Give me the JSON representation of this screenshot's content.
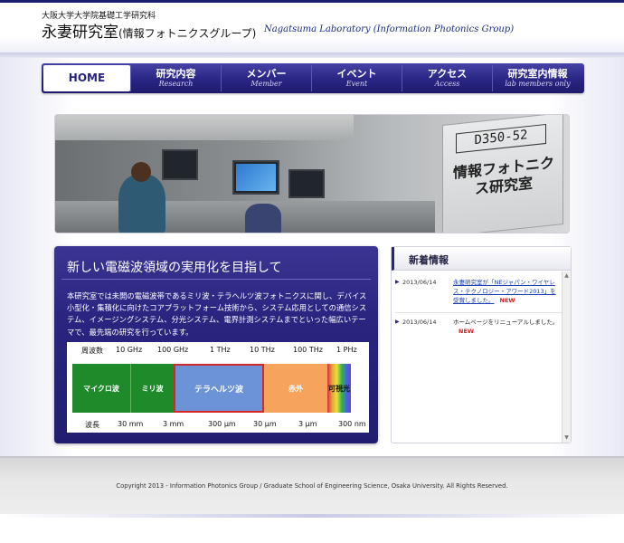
{
  "header": {
    "subtitle": "大阪大学大学院基礎工学研究科",
    "title": "永妻研究室",
    "title_paren": "(情報フォトニクスグループ)",
    "english": "Nagatsuma Laboratory (Information Photonics Group)"
  },
  "nav": {
    "items": [
      {
        "jp": "HOME",
        "en": ""
      },
      {
        "jp": "研究内容",
        "en": "Research"
      },
      {
        "jp": "メンバー",
        "en": "Member"
      },
      {
        "jp": "イベント",
        "en": "Event"
      },
      {
        "jp": "アクセス",
        "en": "Access"
      },
      {
        "jp": "研究室内情報",
        "en": "lab members only"
      }
    ],
    "active_index": 0
  },
  "hero": {
    "sign_number": "D350-52",
    "sign_text": "情報フォトニクス研究室"
  },
  "main": {
    "title": "新しい電磁波領域の実用化を目指して",
    "text": "本研究室では未開の電磁波帯であるミリ波・テラヘルツ波フォトニクスに関し、デバイス小型化・集積化に向けたコアプラットフォーム技術から、システム応用としての通信システム、イメージングシステム、分光システム、電界計測システムまでといった幅広いテーマで、最先端の研究を行っています。",
    "chart": {
      "freq_label": "周波数",
      "freq_ticks": [
        "10 GHz",
        "100 GHz",
        "1 THz",
        "10 THz",
        "100 THz",
        "1 PHz"
      ],
      "wave_label": "波長",
      "wave_ticks": [
        "30 mm",
        "3 mm",
        "300 μm",
        "30 μm",
        "3 μm",
        "300 nm"
      ],
      "bands": [
        {
          "name": "マイクロ波",
          "color": "#1f8a2a"
        },
        {
          "name": "ミリ波",
          "color": "#1f8a2a"
        },
        {
          "name": "テラヘルツ波",
          "color": "#6c93d6"
        },
        {
          "name": "赤外",
          "color": "#f6a45c"
        },
        {
          "name": "可視光",
          "color": "#c14ea3"
        }
      ]
    }
  },
  "news": {
    "title": "新着情報",
    "items": [
      {
        "date": "2013/06/14",
        "text": "永妻研究室が「NEジャパン・ワイヤレス・テクノロジー・アワード2013」を受賞しました。",
        "new": "NEW",
        "link": true
      },
      {
        "date": "2013/06/14",
        "text": "ホームページをリニューアルしました。",
        "new": "NEW",
        "link": false
      }
    ]
  },
  "footer": {
    "copyright": "Copyright 2013 - Information Photonics Group / Graduate School of Engineering Science, Osaka University. All Rights Reserved."
  },
  "colors": {
    "nav_dark": "#1e1a6c",
    "accent": "#2a2680",
    "new_red": "#e01d1d",
    "link_blue": "#1b3fb0"
  }
}
